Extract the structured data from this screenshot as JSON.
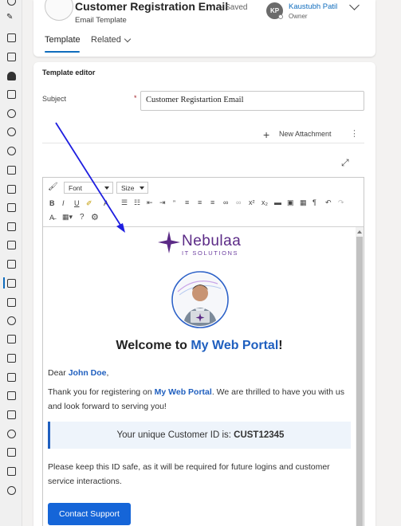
{
  "header": {
    "title": "Customer Registration Email",
    "status": "- Saved",
    "record_type": "Email Template",
    "owner": {
      "initials": "KP",
      "name": "Kaustubh Patil",
      "role": "Owner"
    },
    "tabs": [
      {
        "label": "Template"
      },
      {
        "label": "Related"
      }
    ]
  },
  "form": {
    "section_title": "Template editor",
    "subject_label": "Subject",
    "required_mark": "*",
    "subject_value": "Customer Registartion Email",
    "new_attachment_label": "New Attachment"
  },
  "toolbar": {
    "font_label": "Font",
    "size_label": "Size"
  },
  "email": {
    "logo_name": "Nebulaa",
    "logo_sub": "IT SOLUTIONS",
    "welcome_prefix": "Welcome to ",
    "welcome_accent": "My Web Portal",
    "welcome_suffix": "!",
    "greeting_prefix": "Dear ",
    "customer_name": "John Doe",
    "greeting_suffix": ",",
    "thanks_prefix": "Thank you for registering on ",
    "thanks_accent": "My Web Portal",
    "thanks_suffix": ". We are thrilled to have you with us and look forward to serving you!",
    "id_prefix": "Your unique Customer ID is: ",
    "customer_id": "CUST12345",
    "keep_safe": "Please keep this ID safe, as it will be required for future logins and customer service interactions.",
    "cta_label": "Contact Support"
  },
  "colors": {
    "accent": "#1f5fbf",
    "brand_purple": "#5b2a86",
    "button": "#1565d8",
    "annotation_arrow": "#1e1ee0"
  }
}
